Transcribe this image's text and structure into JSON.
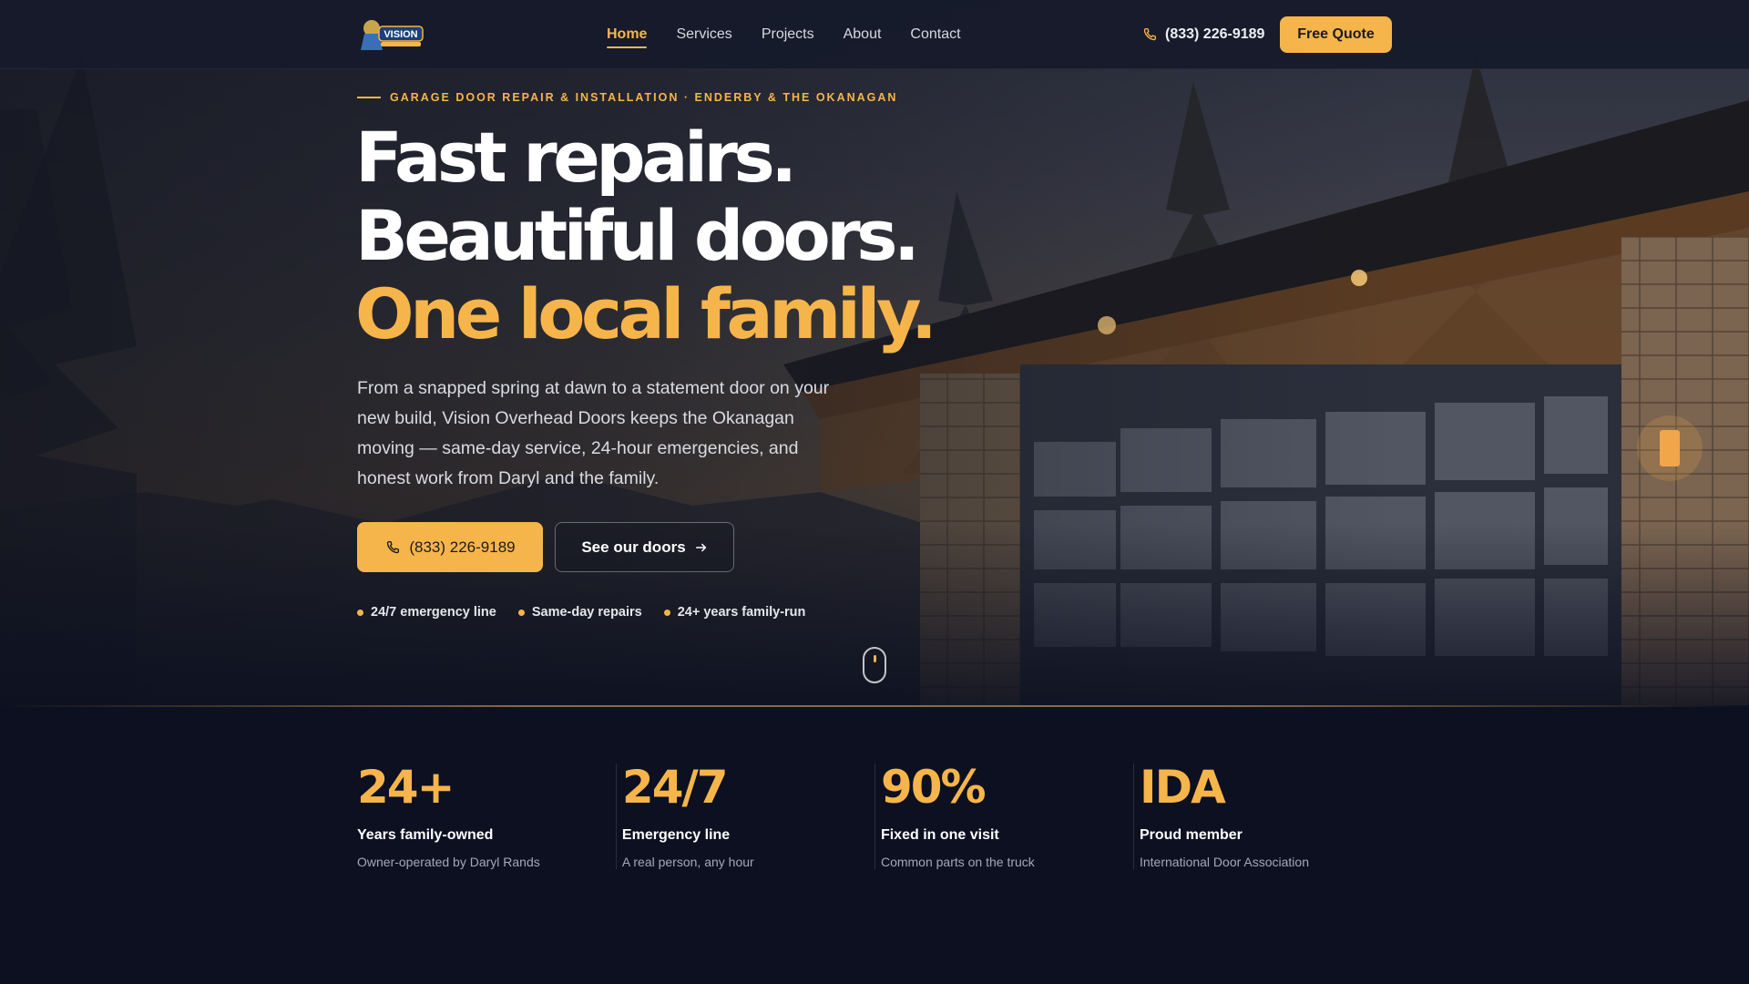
{
  "nav": {
    "logo_text": "VISION",
    "links": [
      {
        "label": "Home",
        "active": true
      },
      {
        "label": "Services",
        "active": false
      },
      {
        "label": "Projects",
        "active": false
      },
      {
        "label": "About",
        "active": false
      },
      {
        "label": "Contact",
        "active": false
      }
    ],
    "phone": "(833) 226-9189",
    "cta_label": "Free Quote",
    "phone_icon": "phone-icon"
  },
  "hero": {
    "eyebrow": "GARAGE DOOR REPAIR & INSTALLATION · ENDERBY & THE OKANAGAN",
    "headline": [
      "Fast repairs.",
      "Beautiful doors.",
      "One local family."
    ],
    "lede": "From a snapped spring at dawn to a statement door on your new build, Vision Overhead Doors keeps the Okanagan moving — same-day service, 24-hour emergencies, and honest work from Daryl and the family.",
    "primary_button": "(833) 226-9189",
    "secondary_button": "See our doors",
    "bullets": [
      "24/7 emergency line",
      "Same-day repairs",
      "24+ years family-run"
    ]
  },
  "stats": [
    {
      "value": "24+",
      "title": "Years family-owned",
      "sub": "Owner-operated by Daryl Rands"
    },
    {
      "value": "24/7",
      "title": "Emergency line",
      "sub": "A real person, any hour"
    },
    {
      "value": "90%",
      "title": "Fixed in one visit",
      "sub": "Common parts on the truck"
    },
    {
      "value": "IDA",
      "title": "Proud member",
      "sub": "International Door Association"
    }
  ],
  "colors": {
    "accent": "#f6b54a",
    "background": "#0c1020",
    "nav": "#161a2a"
  }
}
